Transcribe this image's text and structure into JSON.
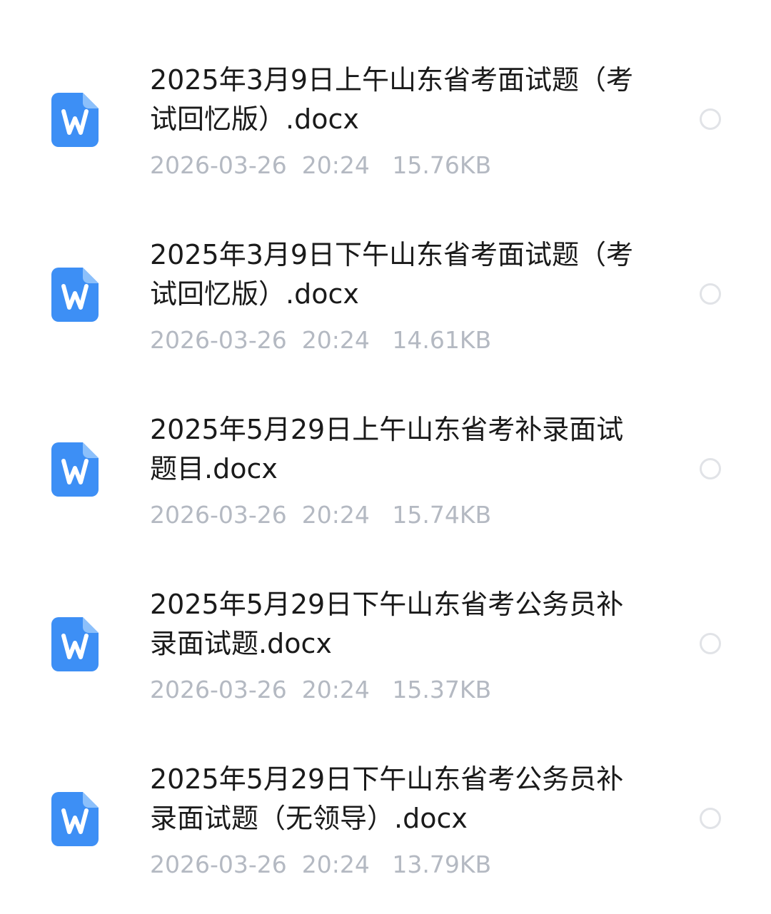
{
  "accent_color": "#3d8ff5",
  "files": [
    {
      "name": "2025年3月9日上午山东省考面试题（考试回忆版）.docx",
      "date": "2026-03-26",
      "time": "20:24",
      "size": "15.76KB",
      "icon": "word-doc-icon",
      "selected": false
    },
    {
      "name": "2025年3月9日下午山东省考面试题（考试回忆版）.docx",
      "date": "2026-03-26",
      "time": "20:24",
      "size": "14.61KB",
      "icon": "word-doc-icon",
      "selected": false
    },
    {
      "name": "2025年5月29日上午山东省考补录面试题目.docx",
      "date": "2026-03-26",
      "time": "20:24",
      "size": "15.74KB",
      "icon": "word-doc-icon",
      "selected": false
    },
    {
      "name": "2025年5月29日下午山东省考公务员补录面试题.docx",
      "date": "2026-03-26",
      "time": "20:24",
      "size": "15.37KB",
      "icon": "word-doc-icon",
      "selected": false
    },
    {
      "name": "2025年5月29日下午山东省考公务员补录面试题（无领导）.docx",
      "date": "2026-03-26",
      "time": "20:24",
      "size": "13.79KB",
      "icon": "word-doc-icon",
      "selected": false
    }
  ]
}
